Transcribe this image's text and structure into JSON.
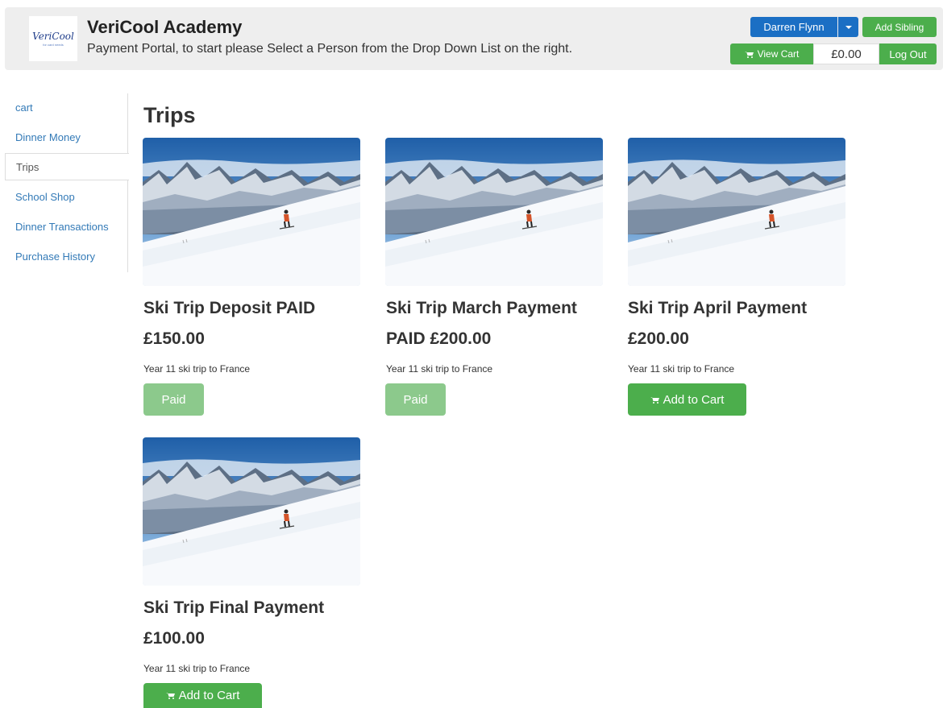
{
  "header": {
    "logo_text": "VeriCool",
    "logo_sub": "for card needs",
    "title": "VeriCool Academy",
    "subtitle": "Payment Portal, to start please Select a Person from the Drop Down List on the right.",
    "person_label": "Darren Flynn",
    "add_sibling_label": "Add Sibling",
    "view_cart_label": "View Cart",
    "cart_total": "£0.00",
    "logout_label": "Log Out",
    "cart_icon": "shopping-cart-icon",
    "caret_icon": "caret-down-icon"
  },
  "sidebar": {
    "items": [
      {
        "label": "cart",
        "active": false
      },
      {
        "label": "Dinner Money",
        "active": false
      },
      {
        "label": "Trips",
        "active": true
      },
      {
        "label": "School Shop",
        "active": false
      },
      {
        "label": "Dinner Transactions",
        "active": false
      },
      {
        "label": "Purchase History",
        "active": false
      }
    ]
  },
  "main": {
    "title": "Trips",
    "cards": [
      {
        "title": "Ski Trip Deposit PAID £150.00",
        "description": "Year 11 ski trip to France",
        "button": "Paid",
        "status": "paid"
      },
      {
        "title": "Ski Trip March Payment PAID £200.00",
        "description": "Year 11 ski trip to France",
        "button": "Paid",
        "status": "paid"
      },
      {
        "title": "Ski Trip April Payment £200.00",
        "description": "Year 11 ski trip to France",
        "button": "Add to Cart",
        "status": "unpaid"
      },
      {
        "title": "Ski Trip Final Payment £100.00",
        "description": "Year 11 ski trip to France",
        "button": "Add to Cart",
        "status": "unpaid"
      }
    ]
  },
  "colors": {
    "primary": "#1b6fc4",
    "success": "#4cae4c",
    "success_disabled": "#8cc98c",
    "link": "#337ab7",
    "header_bg": "#eeeeee"
  }
}
